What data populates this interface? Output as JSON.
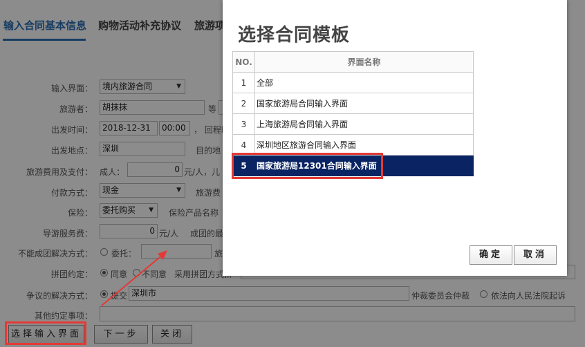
{
  "tabs": [
    "输入合同基本信息",
    "购物活动补充协议",
    "旅游项"
  ],
  "form": {
    "interface_label": "输入界面：",
    "interface_value": "境内旅游合同",
    "traveler_label": "旅游者：",
    "traveler_value": "胡抹抹",
    "traveler_suffix": "等",
    "depart_time_label": "出发时间：",
    "depart_date": "2018-12-31",
    "depart_hour": "00:00",
    "return_label": "， 回程时",
    "depart_place_label": "出发地点：",
    "depart_place_value": "深圳",
    "destination_label": "目的地",
    "fee_label": "旅游费用及支付：",
    "adult_label": "成人：",
    "adult_value": "0",
    "per_person_child": "元/人，儿",
    "payment_label": "付款方式：",
    "payment_value": "现金",
    "travel_fee_label": "旅游费",
    "insurance_label": "保险：",
    "insurance_value": "委托购买",
    "insurance_product_label": "保险产品名称",
    "guide_fee_label": "导游服务费：",
    "guide_fee_value": "0",
    "guide_fee_unit": "元/人",
    "group_min_label": "成团的最",
    "no_group_label": "不能成团解决方式：",
    "entrust_label": "委托：",
    "travel_suffix": "旅",
    "joint_label": "拼团约定：",
    "agree_label": "同意",
    "disagree_label": "不同意",
    "joint_method_label": "采用拼团方式拼",
    "dispute_label": "争议的解决方式：",
    "submit_label": "提交",
    "dispute_city": "深圳市",
    "arbitration_label": "仲裁委员会仲裁",
    "court_label": "依法向人民法院起诉",
    "other_label": "其他约定事项：",
    "btn_select": "选择输入界面",
    "btn_next": "下一步",
    "btn_close": "关闭"
  },
  "dialog": {
    "title": "选择合同模板",
    "col_no": "NO.",
    "col_name": "界面名称",
    "rows": [
      {
        "no": "1",
        "name": "全部"
      },
      {
        "no": "2",
        "name": "国家旅游局合同输入界面"
      },
      {
        "no": "3",
        "name": "上海旅游局合同输入界面"
      },
      {
        "no": "4",
        "name": "深圳地区旅游合同输入界面"
      },
      {
        "no": "5",
        "name": "国家旅游局12301合同输入界面"
      }
    ],
    "selected_index": 4,
    "ok_label": "确定",
    "cancel_label": "取消"
  },
  "colors": {
    "tab_active": "#2a6fb5",
    "selected_row": "#0a2463",
    "annotation": "#e53935"
  }
}
